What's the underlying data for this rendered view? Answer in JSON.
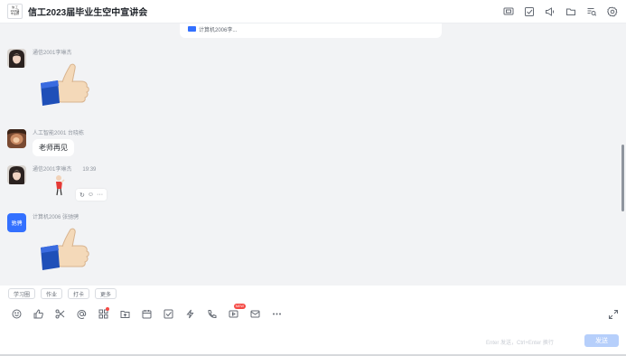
{
  "header": {
    "group_title": "信工2023届毕业生空中宣讲会",
    "group_avatar_lines": [
      "信 工",
      "2023届",
      "毕业群"
    ],
    "tools": [
      "screen-share-icon",
      "task-check-icon",
      "announcement-icon",
      "folder-icon",
      "search-list-icon",
      "settings-icon"
    ]
  },
  "pinned": {
    "text": "计算机2006李..."
  },
  "messages": [
    {
      "sender": "通信2001李琳杰",
      "time": "",
      "type": "sticker",
      "sticker": "thumbs-up"
    },
    {
      "sender": "人工智能2001 台晓栋",
      "time": "",
      "type": "text",
      "text": "老师再见"
    },
    {
      "sender": "通信2001李琳杰",
      "time": "19:39",
      "type": "sticker",
      "sticker": "small-figure"
    },
    {
      "sender": "计算机2006 张驰骋",
      "time": "",
      "type": "sticker",
      "sticker": "thumbs-up",
      "avatar_text": "驰骋"
    }
  ],
  "message_actions": [
    "↻",
    "☺",
    "···"
  ],
  "quick_tags": [
    "学习圈",
    "作业",
    "打卡",
    "更多"
  ],
  "toolbar": {
    "items": [
      "emoji-icon",
      "thumbs-up-icon",
      "scissors-icon",
      "mention-icon",
      "apps-icon",
      "upload-icon",
      "calendar-icon",
      "task-icon",
      "lightning-icon",
      "call-icon",
      "live-icon",
      "mail-icon",
      "more-icon"
    ],
    "new_badge": "NEW"
  },
  "composer": {
    "hint": "Enter 发送，Ctrl+Enter 换行",
    "send_label": "发送"
  },
  "colors": {
    "accent": "#3370ff",
    "send_disabled": "#b6cffb",
    "chat_bg": "#f2f3f5"
  }
}
